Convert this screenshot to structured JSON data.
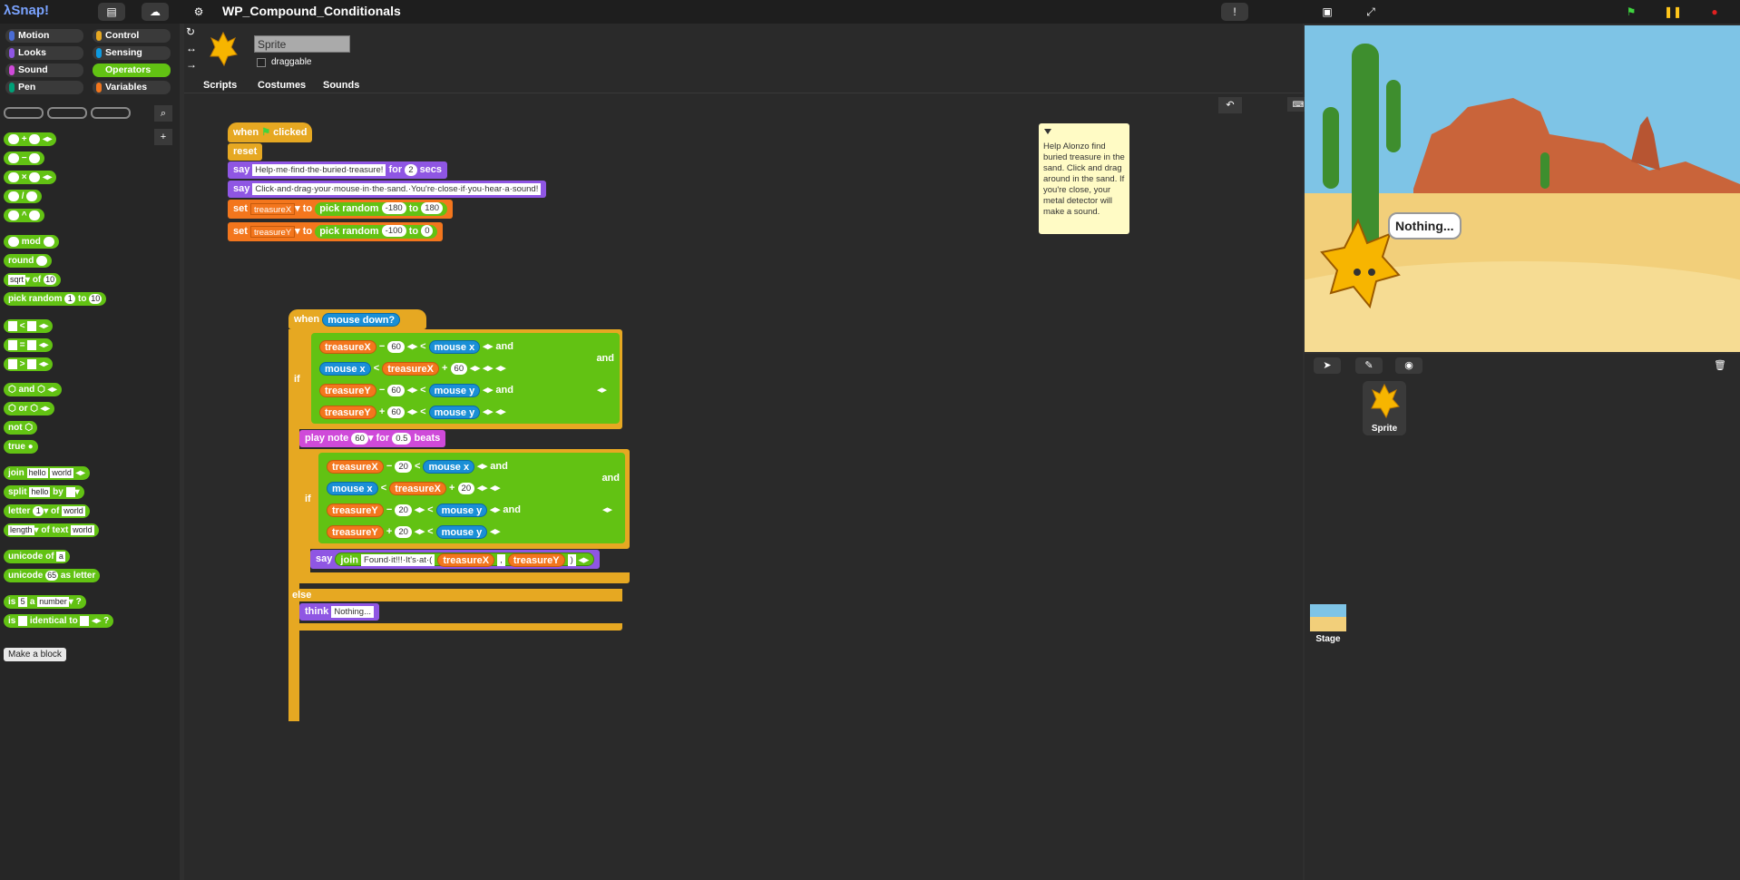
{
  "app": {
    "logo": "Snap!",
    "project_title": "WP_Compound_Conditionals"
  },
  "categories": [
    {
      "label": "Motion",
      "color": "#4a6cd4"
    },
    {
      "label": "Control",
      "color": "#e6a822"
    },
    {
      "label": "Looks",
      "color": "#8f56e3"
    },
    {
      "label": "Sensing",
      "color": "#0e9ae0"
    },
    {
      "label": "Sound",
      "color": "#cf4ad9"
    },
    {
      "label": "Operators",
      "color": "#62c213"
    },
    {
      "label": "Pen",
      "color": "#00a178"
    },
    {
      "label": "Variables",
      "color": "#f3761d"
    }
  ],
  "palette": {
    "ops": [
      "+",
      "−",
      "×",
      "/",
      "^"
    ],
    "mod": "mod",
    "round": "round",
    "sqrt": "sqrt",
    "of": "of",
    "sqrt_val": "10",
    "pick_random": "pick random",
    "pr_from": "1",
    "to": "to",
    "pr_to": "10",
    "compare": [
      "<",
      "=",
      ">"
    ],
    "and": "and",
    "or": "or",
    "not": "not",
    "true": "true",
    "join": "join",
    "hello": "hello",
    "world": "world",
    "split": "split",
    "by": "by",
    "letter": "letter",
    "letter_idx": "1",
    "length": "length",
    "of_text": "of text",
    "unicode_of": "unicode of",
    "unicode_a": "a",
    "unicode": "unicode",
    "unicode_num": "65",
    "as_letter": "as letter",
    "is": "is",
    "is_val": "5",
    "a": "a",
    "number": "number",
    "q": "?",
    "identical_to": "identical to",
    "make_block": "Make a block"
  },
  "sprite": {
    "name": "Sprite",
    "draggable": "draggable"
  },
  "tabs": [
    "Scripts",
    "Costumes",
    "Sounds"
  ],
  "script1": {
    "when": "when",
    "clicked": "clicked",
    "reset": "reset",
    "say": "say",
    "say1": "Help·me·find·the·buried·treasure!",
    "for": "for",
    "secs_val": "2",
    "secs": "secs",
    "say2": "Click·and·drag·your·mouse·in·the·sand.·You're·close·if·you·hear·a·sound!",
    "set": "set",
    "tx": "treasureX",
    "ty": "treasureY",
    "to": "to",
    "pick_random": "pick random",
    "x_from": "-180",
    "x_to": "180",
    "y_from": "-100",
    "y_to": "0"
  },
  "script2": {
    "when": "when",
    "mouse_down": "mouse down?",
    "if": "if",
    "and": "and",
    "else": "else",
    "tx": "treasureX",
    "ty": "treasureY",
    "mx": "mouse x",
    "my": "mouse y",
    "minus": "−",
    "plus": "+",
    "lt": "<",
    "v60": "60",
    "v20": "20",
    "play_note": "play note",
    "note": "60",
    "for": "for",
    "beats_val": "0.5",
    "beats": "beats",
    "say": "say",
    "join": "join",
    "found": "Found·it!!!·It's·at·(",
    "comma": ",",
    "close": ")",
    "think": "think",
    "nothing": "Nothing..."
  },
  "comment": "Help Alonzo find buried treasure in the sand. Click and drag around in the sand. If you're close, your metal detector will make a sound.",
  "stage": {
    "bubble": "Nothing..."
  },
  "corral": {
    "sprite": "Sprite",
    "stage": "Stage"
  }
}
